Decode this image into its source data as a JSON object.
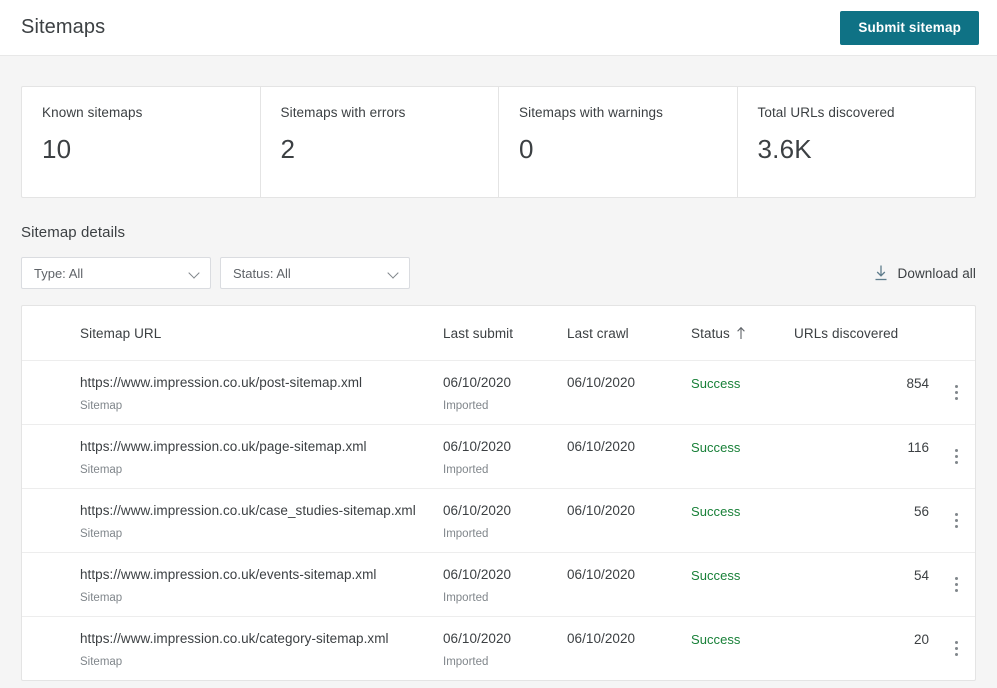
{
  "header": {
    "title": "Sitemaps",
    "submit_label": "Submit sitemap",
    "accent_color": "#0f7285"
  },
  "stats": [
    {
      "label": "Known sitemaps",
      "value": "10"
    },
    {
      "label": "Sitemaps with errors",
      "value": "2"
    },
    {
      "label": "Sitemaps with warnings",
      "value": "0"
    },
    {
      "label": "Total URLs discovered",
      "value": "3.6K"
    }
  ],
  "details": {
    "title": "Sitemap details",
    "filters": [
      {
        "name": "type-filter",
        "value": "Type: All"
      },
      {
        "name": "status-filter",
        "value": "Status: All"
      }
    ],
    "download_label": "Download all",
    "download_icon": "download-arrow-icon"
  },
  "table": {
    "columns": {
      "url": "Sitemap URL",
      "last_submit": "Last submit",
      "last_crawl": "Last crawl",
      "status": "Status",
      "urls_discovered": "URLs discovered"
    },
    "sort": {
      "column": "status",
      "direction": "ascending",
      "icon": "arrow-up-icon"
    },
    "status_color": "#188038",
    "rows": [
      {
        "url": "https://www.impression.co.uk/post-sitemap.xml",
        "type": "Sitemap",
        "last_submit": "06/10/2020",
        "submit_note": "Imported",
        "last_crawl": "06/10/2020",
        "status": "Success",
        "urls_discovered": "854"
      },
      {
        "url": "https://www.impression.co.uk/page-sitemap.xml",
        "type": "Sitemap",
        "last_submit": "06/10/2020",
        "submit_note": "Imported",
        "last_crawl": "06/10/2020",
        "status": "Success",
        "urls_discovered": "116"
      },
      {
        "url": "https://www.impression.co.uk/case_studies-sitemap.xml",
        "type": "Sitemap",
        "last_submit": "06/10/2020",
        "submit_note": "Imported",
        "last_crawl": "06/10/2020",
        "status": "Success",
        "urls_discovered": "56"
      },
      {
        "url": "https://www.impression.co.uk/events-sitemap.xml",
        "type": "Sitemap",
        "last_submit": "06/10/2020",
        "submit_note": "Imported",
        "last_crawl": "06/10/2020",
        "status": "Success",
        "urls_discovered": "54"
      },
      {
        "url": "https://www.impression.co.uk/category-sitemap.xml",
        "type": "Sitemap",
        "last_submit": "06/10/2020",
        "submit_note": "Imported",
        "last_crawl": "06/10/2020",
        "status": "Success",
        "urls_discovered": "20"
      }
    ]
  }
}
